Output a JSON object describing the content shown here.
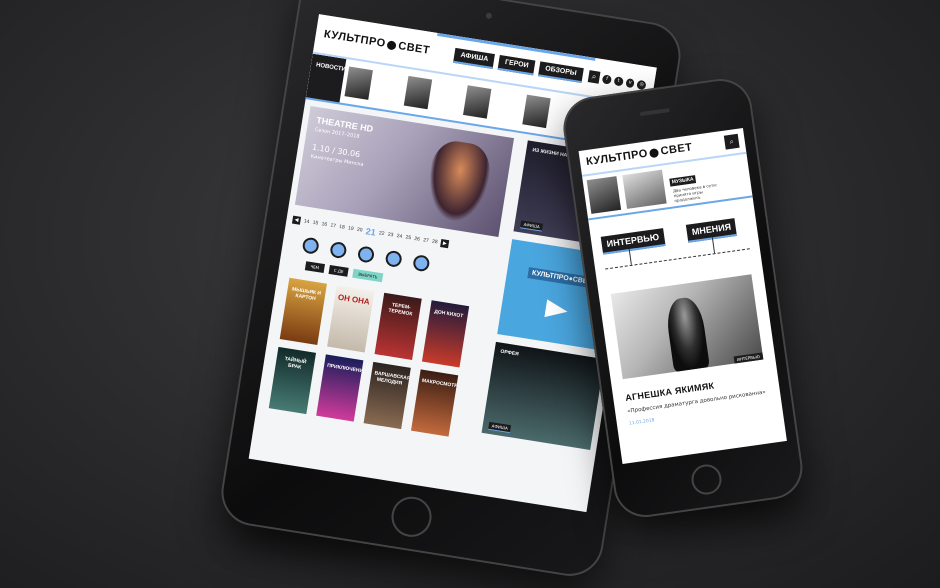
{
  "site": {
    "logo_left": "КУЛЬТПРО",
    "logo_right": "СВЕТ"
  },
  "tablet": {
    "nav": [
      "АФИША",
      "ГЕРОИ",
      "ОБЗОРЫ"
    ],
    "news_label": "НОВОСТИ",
    "hero": {
      "title": "THEATRE HD",
      "subtitle": "Сезон 2017–2018",
      "dates": "1.10 / 30.06",
      "venue": "Кинотеатры Минска"
    },
    "calendar_days": [
      "14",
      "15",
      "16",
      "17",
      "18",
      "19",
      "20",
      "21",
      "22",
      "23",
      "24",
      "25",
      "26",
      "27",
      "28"
    ],
    "active_day": "21",
    "filters": [
      "ЧЕМ",
      "С ДЕ",
      "ВЫБРАТЬ"
    ],
    "posters": [
      "МЫШЬЯК И КАРТОН",
      "ОН ОНА",
      "ТЕРЕМ-ТЕРЕМОК",
      "ДОН КИХОТ",
      "ТАЙНЫЙ БРАК",
      "ПРИКЛЮЧЕНИЯ",
      "ВАРШАВСКАЯ МЕЛОДИЯ",
      "МАКРОСМОТР"
    ],
    "side_card_1": {
      "label": "ИЗ ЖИЗНИ НАСЕКОМЫХ",
      "tag": "АФИША"
    },
    "side_card_2": {
      "label": "ОРФЕЯ",
      "tag": "АФИША"
    }
  },
  "phone": {
    "news": [
      {
        "badge": "МУЗЫКА",
        "text": "Два человека в сети: принято игры продолжить"
      }
    ],
    "tabs": [
      "ИНТЕРВЬЮ",
      "МНЕНИЯ"
    ],
    "photo_tag": "ИНТЕРВЬЮ",
    "article": {
      "name": "АГНЕШКА ЯКИМЯК",
      "quote": "«Профессия драматурга довольно рискованна»",
      "date": "11.01.2018"
    }
  }
}
